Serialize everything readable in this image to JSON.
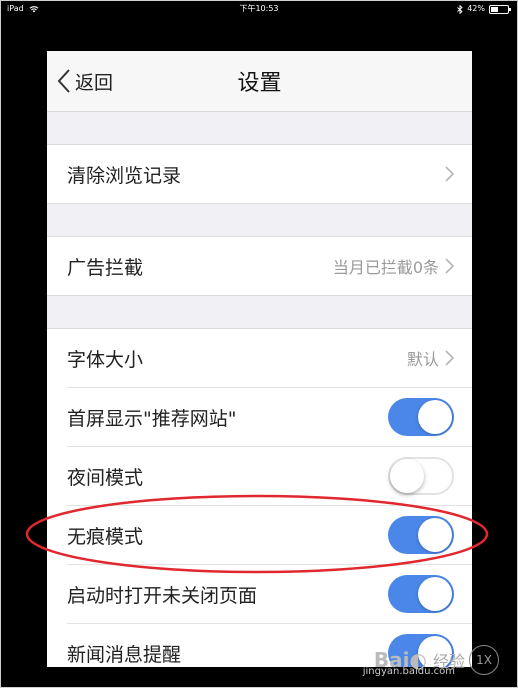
{
  "status_bar": {
    "device": "iPad",
    "time": "下午10:53",
    "battery_text": "42%",
    "battery_level": 0.42
  },
  "nav": {
    "back_label": "返回",
    "title": "设置"
  },
  "rows": {
    "clear_history": {
      "label": "清除浏览记录"
    },
    "ad_block": {
      "label": "广告拦截",
      "value": "当月已拦截0条"
    },
    "font_size": {
      "label": "字体大小",
      "value": "默认"
    },
    "home_recommend": {
      "label": "首屏显示\"推荐网站\"",
      "on": true
    },
    "night_mode": {
      "label": "夜间模式",
      "on": false
    },
    "incognito": {
      "label": "无痕模式",
      "on": true
    },
    "restore_pages": {
      "label": "启动时打开未关闭页面",
      "on": true
    },
    "news_alert": {
      "label": "新闻消息提醒",
      "on": true
    }
  },
  "watermark": {
    "logo": "Bai",
    "logo_suffix": "经验",
    "url": "jingyan.baidu.com",
    "badge": "1X"
  },
  "colors": {
    "toggle_on": "#4a87e8",
    "annotation_ellipse": "#e0282e",
    "background": "#efeff4"
  }
}
